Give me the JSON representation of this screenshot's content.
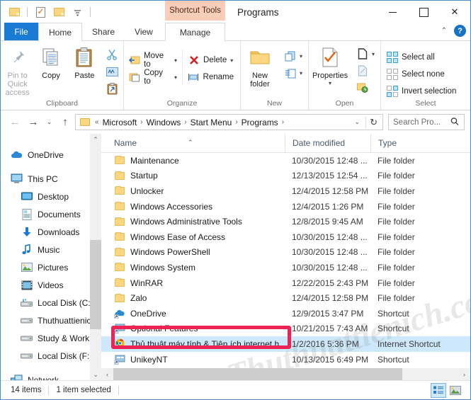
{
  "titlebar": {
    "quick_access": [
      {
        "name": "folder-icon",
        "label": ""
      },
      {
        "name": "properties-icon",
        "label": ""
      },
      {
        "name": "new-folder-icon",
        "label": ""
      },
      {
        "name": "customize-dropdown-icon",
        "label": "▾"
      }
    ],
    "contextual_tab_group": "Shortcut Tools",
    "window_title": "Programs",
    "controls": {
      "minimize": "",
      "maximize": "",
      "close": "✕"
    }
  },
  "tabs": {
    "file": "File",
    "items": [
      "Home",
      "Share",
      "View"
    ],
    "contextual": "Manage",
    "collapse_caret": "⌃",
    "help": "?"
  },
  "ribbon": {
    "groups": [
      {
        "label": "Clipboard",
        "big_buttons": [
          {
            "label": "Pin to Quick access",
            "icon": "pin-icon",
            "disabled": true
          },
          {
            "label": "Copy",
            "icon": "copy-icon",
            "disabled": false
          },
          {
            "label": "Paste",
            "icon": "paste-icon",
            "disabled": false
          }
        ],
        "small_buttons": [
          {
            "label": "",
            "icon": "cut-icon"
          },
          {
            "label": "",
            "icon": "copy-path-icon"
          },
          {
            "label": "",
            "icon": "paste-shortcut-icon"
          }
        ]
      },
      {
        "label": "Organize",
        "small_buttons": [
          {
            "label": "Move to",
            "icon": "move-to-icon",
            "caret": "▾"
          },
          {
            "label": "Copy to",
            "icon": "copy-to-icon",
            "caret": "▾"
          },
          {
            "label": "Delete",
            "icon": "delete-icon",
            "caret": "▾"
          },
          {
            "label": "Rename",
            "icon": "rename-icon",
            "caret": ""
          }
        ]
      },
      {
        "label": "New",
        "big_buttons": [
          {
            "label": "New folder",
            "icon": "new-folder-icon",
            "disabled": false
          }
        ],
        "small_buttons": [
          {
            "label": "",
            "icon": "new-item-icon",
            "caret": "▾"
          },
          {
            "label": "",
            "icon": "easy-access-icon",
            "caret": "▾"
          }
        ]
      },
      {
        "label": "Open",
        "big_buttons": [
          {
            "label": "Properties",
            "icon": "properties-icon",
            "caret": "▾"
          }
        ],
        "small_buttons": [
          {
            "label": "",
            "icon": "open-icon",
            "caret": "▾"
          },
          {
            "label": "",
            "icon": "edit-icon"
          },
          {
            "label": "",
            "icon": "history-icon"
          }
        ]
      },
      {
        "label": "Select",
        "small_buttons": [
          {
            "label": "Select all",
            "icon": "select-all-icon"
          },
          {
            "label": "Select none",
            "icon": "select-none-icon"
          },
          {
            "label": "Invert selection",
            "icon": "invert-selection-icon"
          }
        ]
      }
    ]
  },
  "addressbar": {
    "back": "←",
    "forward": "→",
    "recent": "⌄",
    "up": "↑",
    "breadcrumbs": [
      "Microsoft",
      "Windows",
      "Start Menu",
      "Programs"
    ],
    "prefix": "«",
    "separator": "›",
    "dropdown_caret": "⌄",
    "refresh": "↻",
    "search_placeholder": "Search Pro...",
    "search_value": "",
    "search_icon": "search-icon"
  },
  "navigation_pane": {
    "items": [
      {
        "label": "OneDrive",
        "icon": "onedrive-icon",
        "indent": 0,
        "gap": true
      },
      {
        "label": "This PC",
        "icon": "this-pc-icon",
        "indent": 0,
        "gap": true
      },
      {
        "label": "Desktop",
        "icon": "desktop-icon",
        "indent": 1,
        "gap": false
      },
      {
        "label": "Documents",
        "icon": "documents-icon",
        "indent": 1,
        "gap": false
      },
      {
        "label": "Downloads",
        "icon": "downloads-icon",
        "indent": 1,
        "gap": false
      },
      {
        "label": "Music",
        "icon": "music-icon",
        "indent": 1,
        "gap": false
      },
      {
        "label": "Pictures",
        "icon": "pictures-icon",
        "indent": 1,
        "gap": false
      },
      {
        "label": "Videos",
        "icon": "videos-icon",
        "indent": 1,
        "gap": false
      },
      {
        "label": "Local Disk (C:)",
        "icon": "drive-icon",
        "indent": 1,
        "gap": false
      },
      {
        "label": "Thuthuattienich",
        "icon": "drive-icon",
        "indent": 1,
        "gap": false
      },
      {
        "label": "Study & Work (E",
        "icon": "drive-icon",
        "indent": 1,
        "gap": false
      },
      {
        "label": "Local Disk (F:)",
        "icon": "drive-icon",
        "indent": 1,
        "gap": false
      },
      {
        "label": "Network",
        "icon": "network-icon",
        "indent": 0,
        "gap": true
      }
    ],
    "scroll_up": "⌃",
    "scroll_down": "⌄"
  },
  "file_list": {
    "columns": [
      "Name",
      "Date modified",
      "Type"
    ],
    "sort_indicator": "⌃",
    "rows": [
      {
        "name": "Maintenance",
        "date": "10/30/2015 12:48 ...",
        "type": "File folder",
        "icon": "folder-icon",
        "selected": false
      },
      {
        "name": "Startup",
        "date": "12/13/2015 12:54 ...",
        "type": "File folder",
        "icon": "folder-icon",
        "selected": false
      },
      {
        "name": "Unlocker",
        "date": "12/4/2015 12:58 PM",
        "type": "File folder",
        "icon": "folder-icon",
        "selected": false
      },
      {
        "name": "Windows Accessories",
        "date": "12/4/2015 1:26 PM",
        "type": "File folder",
        "icon": "folder-icon",
        "selected": false
      },
      {
        "name": "Windows Administrative Tools",
        "date": "12/8/2015 9:45 AM",
        "type": "File folder",
        "icon": "folder-icon",
        "selected": false
      },
      {
        "name": "Windows Ease of Access",
        "date": "10/30/2015 12:48 ...",
        "type": "File folder",
        "icon": "folder-icon",
        "selected": false
      },
      {
        "name": "Windows PowerShell",
        "date": "10/30/2015 12:48 ...",
        "type": "File folder",
        "icon": "folder-icon",
        "selected": false
      },
      {
        "name": "Windows System",
        "date": "10/30/2015 12:48 ...",
        "type": "File folder",
        "icon": "folder-icon",
        "selected": false
      },
      {
        "name": "WinRAR",
        "date": "12/22/2015 2:43 PM",
        "type": "File folder",
        "icon": "folder-icon",
        "selected": false
      },
      {
        "name": "Zalo",
        "date": "12/4/2015 12:58 PM",
        "type": "File folder",
        "icon": "folder-icon",
        "selected": false
      },
      {
        "name": "OneDrive",
        "date": "12/9/2015 3:47 PM",
        "type": "Shortcut",
        "icon": "onedrive-shortcut-icon",
        "selected": false
      },
      {
        "name": "Optional Features",
        "date": "10/21/2015 7:43 AM",
        "type": "Shortcut",
        "icon": "shortcut-icon",
        "selected": false
      },
      {
        "name": "Thủ thuật máy tính & Tiện ích internet h...",
        "date": "1/2/2016 5:36 PM",
        "type": "Internet Shortcut",
        "icon": "chrome-shortcut-icon",
        "selected": true
      },
      {
        "name": "UnikeyNT",
        "date": "10/13/2015 6:49 PM",
        "type": "Shortcut",
        "icon": "shortcut-icon",
        "selected": false
      }
    ],
    "hscroll": {
      "left_arrow": "‹",
      "right_arrow": "›"
    }
  },
  "statusbar": {
    "item_count": "14 items",
    "selection": "1 item selected",
    "view_details_icon": "details-view-icon",
    "view_thumbnails_icon": "large-icons-view-icon"
  },
  "watermark": "Thuthuattienich.com",
  "colors": {
    "file_tab_blue": "#1a7bd4",
    "contextual_peach": "#f9cdb8",
    "selection_blue": "#cde8fa",
    "annotation_red": "#ee2255",
    "window_border": "#4a8fd4"
  }
}
